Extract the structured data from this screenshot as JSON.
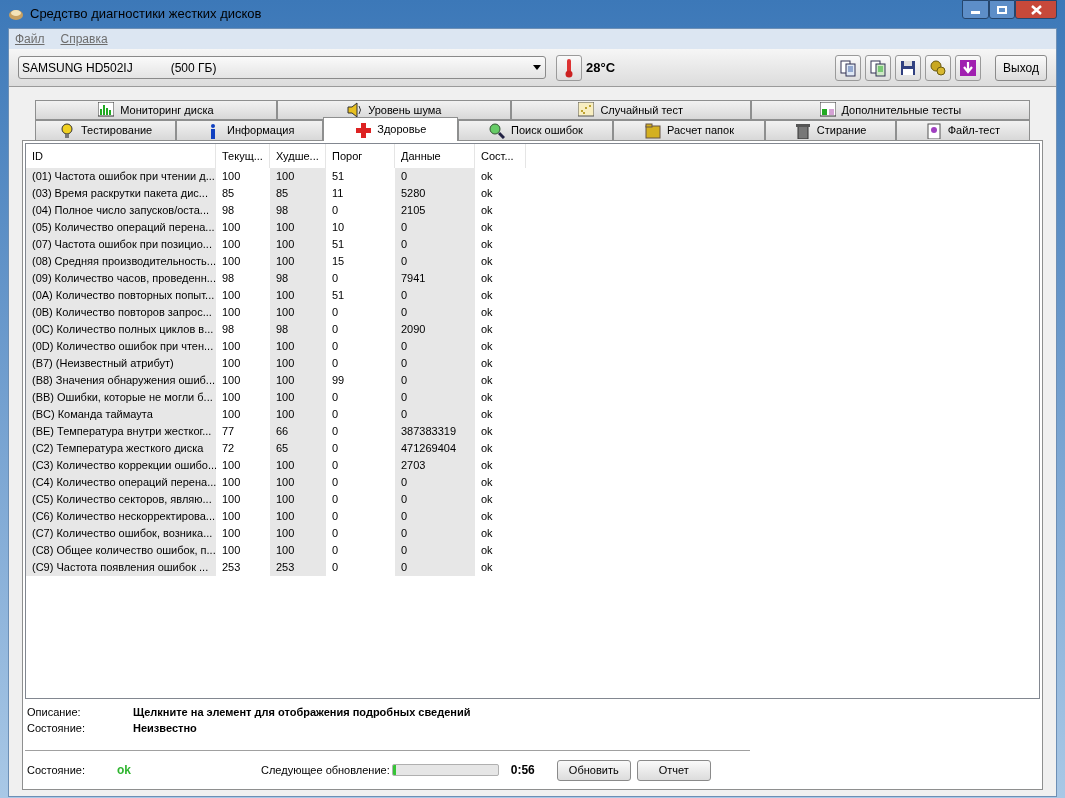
{
  "window": {
    "title": "Средство диагностики жестких дисков"
  },
  "menu": [
    "Файл",
    "Справка"
  ],
  "device": {
    "value": "SAMSUNG HD502IJ",
    "size": "(500 ГБ)"
  },
  "temperature": "28°C",
  "exit_button": "Выход",
  "tabs_row_1": [
    {
      "label": "Мониторинг диска",
      "selected": false
    },
    {
      "label": "Уровень шума",
      "selected": false
    },
    {
      "label": "Случайный тест",
      "selected": false
    },
    {
      "label": "Дополнительные тесты",
      "selected": false
    }
  ],
  "tabs_row_2": [
    {
      "label": "Тестирование",
      "selected": false
    },
    {
      "label": "Информация",
      "selected": false
    },
    {
      "label": "Здоровье",
      "selected": true
    },
    {
      "label": "Поиск ошибок",
      "selected": false
    },
    {
      "label": "Расчет папок",
      "selected": false
    },
    {
      "label": "Стирание",
      "selected": false
    },
    {
      "label": "Файл-тест",
      "selected": false
    }
  ],
  "table": {
    "columns": [
      "ID",
      "Текущ...",
      "Худше...",
      "Порог",
      "Данные",
      "Сост..."
    ],
    "rows": [
      [
        "(01) Частота ошибок при чтении д...",
        "100",
        "100",
        "51",
        "0",
        "ok"
      ],
      [
        "(03) Время раскрутки пакета дис...",
        "85",
        "85",
        "11",
        "5280",
        "ok"
      ],
      [
        "(04) Полное число запусков/оста...",
        "98",
        "98",
        "0",
        "2105",
        "ok"
      ],
      [
        "(05) Количество операций перена...",
        "100",
        "100",
        "10",
        "0",
        "ok"
      ],
      [
        "(07) Частота ошибок при позицио...",
        "100",
        "100",
        "51",
        "0",
        "ok"
      ],
      [
        "(08) Средняя производительность...",
        "100",
        "100",
        "15",
        "0",
        "ok"
      ],
      [
        "(09) Количество часов, проведенн...",
        "98",
        "98",
        "0",
        "7941",
        "ok"
      ],
      [
        "(0A) Количество повторных попыт...",
        "100",
        "100",
        "51",
        "0",
        "ok"
      ],
      [
        "(0B) Количество повторов запрос...",
        "100",
        "100",
        "0",
        "0",
        "ok"
      ],
      [
        "(0C) Количество полных циклов в...",
        "98",
        "98",
        "0",
        "2090",
        "ok"
      ],
      [
        "(0D) Количество ошибок при чтен...",
        "100",
        "100",
        "0",
        "0",
        "ok"
      ],
      [
        "(B7) (Неизвестный атрибут)",
        "100",
        "100",
        "0",
        "0",
        "ok"
      ],
      [
        "(B8) Значения обнаружения ошиб...",
        "100",
        "100",
        "99",
        "0",
        "ok"
      ],
      [
        "(BB) Ошибки, которые не могли б...",
        "100",
        "100",
        "0",
        "0",
        "ok"
      ],
      [
        "(BC) Команда таймаута",
        "100",
        "100",
        "0",
        "0",
        "ok"
      ],
      [
        "(BE) Температура внутри жестког...",
        "77",
        "66",
        "0",
        "387383319",
        "ok"
      ],
      [
        "(C2) Температура жесткого диска",
        "72",
        "65",
        "0",
        "471269404",
        "ok"
      ],
      [
        "(C3) Количество коррекции ошибо...",
        "100",
        "100",
        "0",
        "2703",
        "ok"
      ],
      [
        "(C4) Количество операций перена...",
        "100",
        "100",
        "0",
        "0",
        "ok"
      ],
      [
        "(C5) Количество секторов, являю...",
        "100",
        "100",
        "0",
        "0",
        "ok"
      ],
      [
        "(C6) Количество нескорректирова...",
        "100",
        "100",
        "0",
        "0",
        "ok"
      ],
      [
        "(C7) Количество ошибок, возника...",
        "100",
        "100",
        "0",
        "0",
        "ok"
      ],
      [
        "(C8) Общее количество ошибок, п...",
        "100",
        "100",
        "0",
        "0",
        "ok"
      ],
      [
        "(C9)  Частота появления ошибок ...",
        "253",
        "253",
        "0",
        "0",
        "ok"
      ]
    ]
  },
  "details": [
    {
      "label": "Описание:",
      "value": "Щелкните на элемент для отображения подробных сведений"
    },
    {
      "label": "Состояние:",
      "value": "Неизвестно"
    }
  ],
  "status_bar": {
    "label": "Состояние:",
    "value": "ok",
    "next_update_label": "Следующее обновление:",
    "level": 0.03,
    "time": "0:56",
    "buttons": [
      "Обновить",
      "Отчет"
    ]
  }
}
